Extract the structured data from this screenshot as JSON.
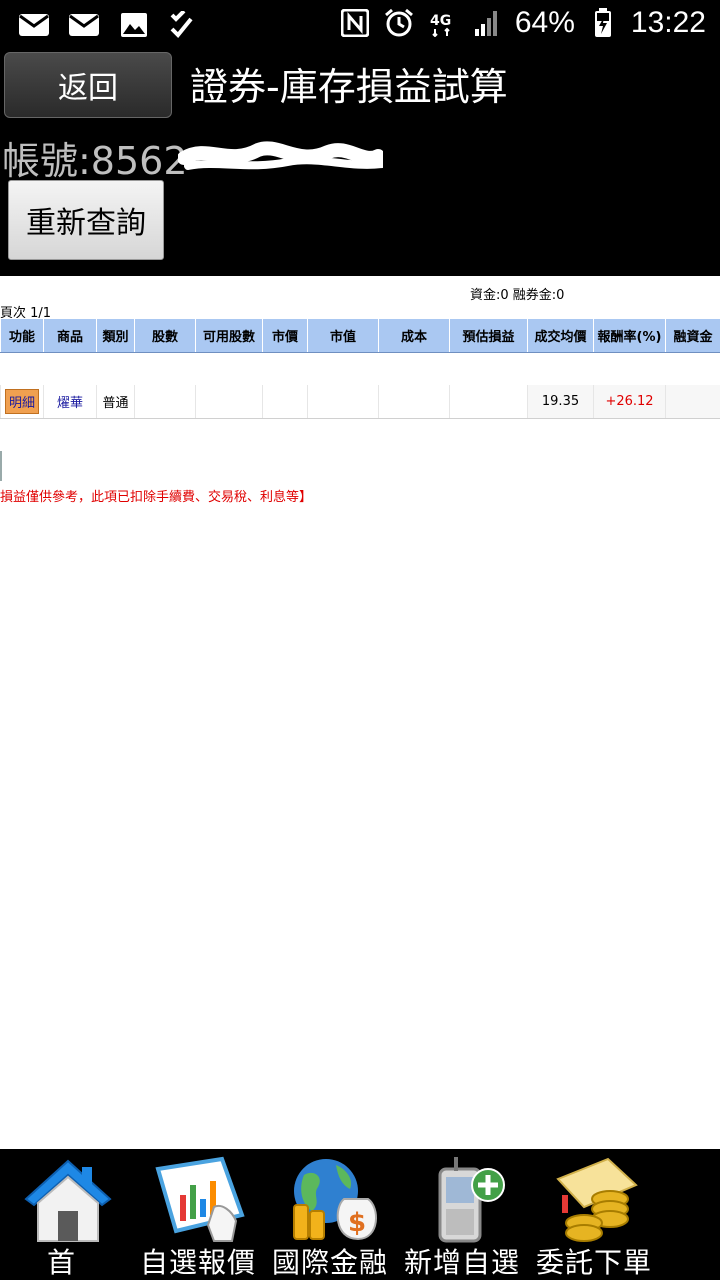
{
  "status_bar": {
    "left_icons": [
      "mail-icon",
      "mail-icon",
      "image-icon",
      "checklist-icon"
    ],
    "right_icons": [
      "nfc-icon",
      "alarm-icon",
      "4g-icon",
      "signal-icon"
    ],
    "battery": "64%",
    "time": "13:22"
  },
  "header": {
    "back_label": "返回",
    "title": "證券-庫存損益試算",
    "account_label": "帳號:8562",
    "requery_label": "重新查詢"
  },
  "summary": {
    "balances": "資金:0 融券金:0",
    "page_count": "頁次 1/1"
  },
  "table": {
    "columns": [
      "功能",
      "商品",
      "類別",
      "股數",
      "可用股數",
      "市價",
      "市值",
      "成本",
      "預估損益",
      "成交均價",
      "報酬率(%)",
      "融資金"
    ],
    "rows": [
      {
        "action": "明細",
        "product": "燿華",
        "category": "普通",
        "shares": "",
        "available_shares": "",
        "market_price": "",
        "market_value": "",
        "cost": "",
        "est_pnl": "",
        "avg_price": "19.35",
        "return_pct": "+26.12",
        "margin": ""
      }
    ]
  },
  "disclaimer": "損益僅供參考，此項已扣除手續費、交易稅、利息等】",
  "bottom_nav": [
    {
      "label": "首頁",
      "icon": "home-icon"
    },
    {
      "label": "自選報價",
      "icon": "chart-quote-icon"
    },
    {
      "label": "國際金融",
      "icon": "globe-money-icon"
    },
    {
      "label": "新增自選",
      "icon": "phone-add-icon"
    },
    {
      "label": "委託下單",
      "icon": "coins-order-icon"
    }
  ],
  "colors": {
    "header_bg": "#000000",
    "table_header_bg": "#aac8f2",
    "positive": "#e00000",
    "detail_button": "#f0a050",
    "link": "#1a1aa0"
  }
}
